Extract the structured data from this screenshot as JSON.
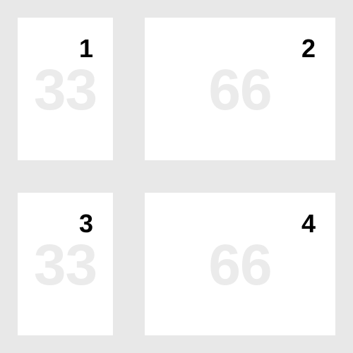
{
  "colors": {
    "background": "#e8e8e8",
    "tile": "#ffffff",
    "number": "#000000",
    "watermark": "#ebebeb"
  },
  "tiles": [
    {
      "number": "1",
      "watermark": "33"
    },
    {
      "number": "2",
      "watermark": "66"
    },
    {
      "number": "3",
      "watermark": "33"
    },
    {
      "number": "4",
      "watermark": "66"
    }
  ]
}
